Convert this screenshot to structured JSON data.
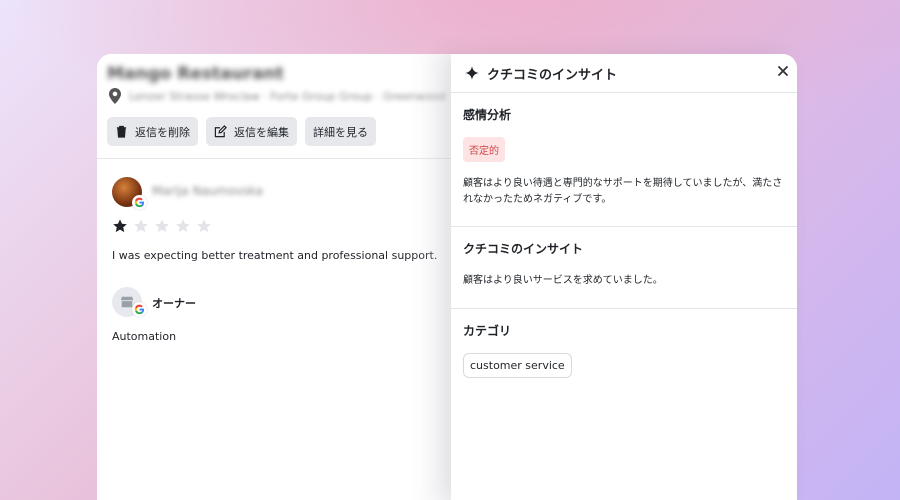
{
  "review": {
    "business_name": "Mango Restaurant",
    "address": "Lenzer Strasse Wroclaw · Forte Group Group · Greenwood",
    "actions": [
      {
        "label": "返信を削除",
        "icon": "trash-icon"
      },
      {
        "label": "返信を編集",
        "icon": "edit-icon"
      },
      {
        "label": "詳細を見る",
        "icon": ""
      }
    ],
    "reviewer_name": "Marija Naumovska",
    "rating": 1,
    "max_rating": 5,
    "text": "I was expecting better treatment and professional support.",
    "owner_label": "オーナー",
    "owner_reply": "Automation"
  },
  "panel": {
    "title": "クチコミのインサイト",
    "sentiment": {
      "heading": "感情分析",
      "badge": "否定的",
      "text": "顧客はより良い待遇と専門的なサポートを期待していましたが、満たされなかったためネガティブです。"
    },
    "insight": {
      "heading": "クチコミのインサイト",
      "text": "顧客はより良いサービスを求めていました。"
    },
    "category": {
      "heading": "カテゴリ",
      "chip": "customer service"
    }
  },
  "colors": {
    "negative_badge_bg": "#fde3e3",
    "negative_badge_text": "#d04545",
    "button_bg": "#e6e8ec"
  }
}
